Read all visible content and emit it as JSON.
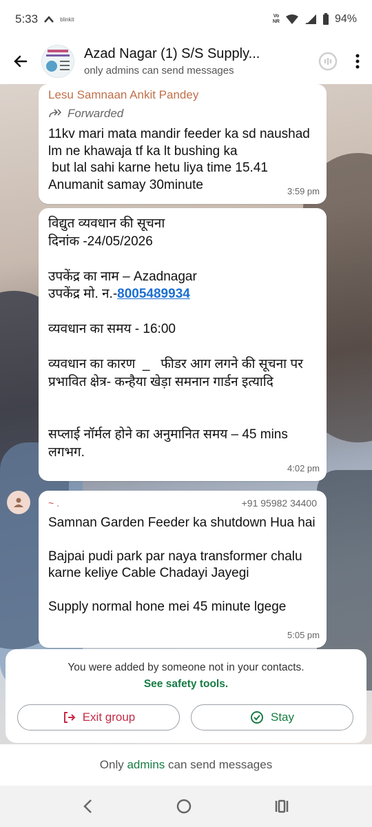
{
  "status_bar": {
    "time": "5:33",
    "app_label": "blinkit",
    "volte_label": "Vo\nNR",
    "battery": "94%"
  },
  "header": {
    "title": "Azad Nagar (1) S/S Supply...",
    "subtitle": "only admins can send messages"
  },
  "messages": [
    {
      "sender_partial": "Lesu Samnaan Ankit Pandey",
      "forwarded_label": "Forwarded",
      "text": "11kv mari mata mandir feeder ka sd naushad lm ne khawaja tf ka lt bushing ka\n but lal sahi karne hetu liya time 15.41\nAnumanit samay 30minute",
      "time": "3:59 pm"
    },
    {
      "line1": "विद्युत व्यवधान की सूचना",
      "line2": "दिनांक -24/05/2026",
      "line3": "उपकेंद्र का नाम – Azadnagar",
      "line4_prefix": "उपकेंद्र मो. न.-",
      "phone_link": "8005489934",
      "line5": "व्यवधान का समय - 16:00",
      "line6": "व्यवधान का कारण  _   फीडर आग लगने की सूचना पर",
      "line7": "प्रभावित क्षेत्र- कन्हैया खेड़ा समनान गार्डन इत्यादि",
      "line8": "सप्लाई नॉर्मल होने का अनुमानित समय – 45 mins लगभग.",
      "time": "4:02 pm"
    },
    {
      "sender_name": "~ .",
      "sender_phone": "+91 95982 34400",
      "text": "Samnan Garden Feeder ka shutdown Hua hai\n\nBajpai pudi park par naya transformer chalu karne keliye Cable Chadayi Jayegi\n\nSupply normal hone mei 45 minute lgege",
      "time": "5:05 pm"
    }
  ],
  "safety": {
    "text": "You were added by someone not in your contacts.",
    "link": "See safety tools.",
    "exit_label": "Exit group",
    "stay_label": "Stay"
  },
  "footer": {
    "prefix": "Only",
    "admins": "admins",
    "suffix": "can send messages"
  },
  "colors": {
    "accent_green": "#167c43",
    "exit_red": "#c62b47",
    "link_blue": "#1c6fd1"
  }
}
